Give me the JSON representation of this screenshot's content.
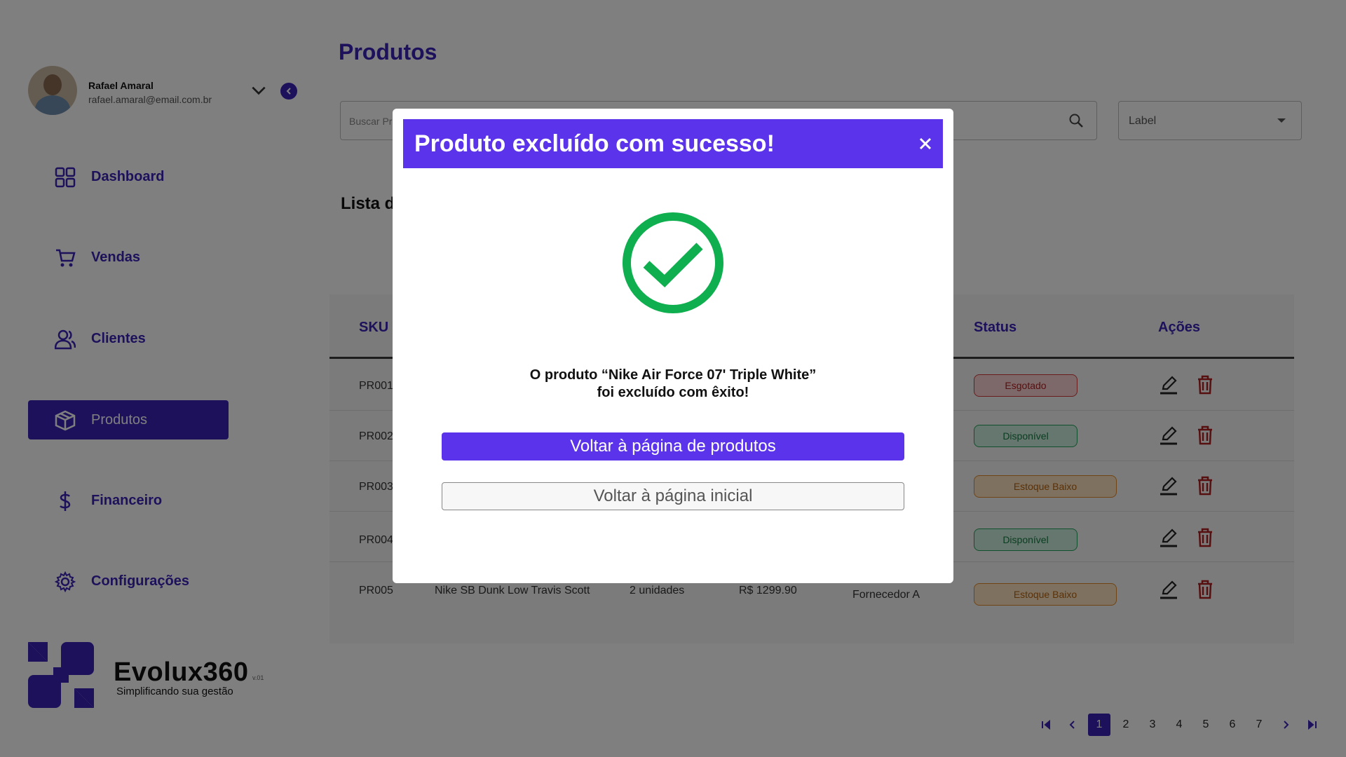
{
  "user": {
    "name": "Rafael Amaral",
    "email": "rafael.amaral@email.com.br"
  },
  "nav": [
    {
      "label": "Dashboard",
      "icon": "grid-icon"
    },
    {
      "label": "Vendas",
      "icon": "cart-icon"
    },
    {
      "label": "Clientes",
      "icon": "users-icon"
    },
    {
      "label": "Produtos",
      "icon": "box-icon",
      "active": true
    },
    {
      "label": "Financeiro",
      "icon": "dollar-icon"
    },
    {
      "label": "Configurações",
      "icon": "gear-icon"
    }
  ],
  "brand": {
    "name": "Evolux360",
    "version": "v.01",
    "tagline": "Simplificando sua gestão"
  },
  "page": {
    "title": "Produtos",
    "list_title": "Lista d"
  },
  "search": {
    "placeholder": "Buscar Pr"
  },
  "filter": {
    "value": "Label"
  },
  "table": {
    "headers": {
      "sku": "SKU",
      "status": "Status",
      "actions": "Ações"
    },
    "rows": [
      {
        "sku": "PR001",
        "status": "Esgotado",
        "status_type": "esgotado"
      },
      {
        "sku": "PR002",
        "status": "Disponível",
        "status_type": "disponivel"
      },
      {
        "sku": "PR003",
        "status": "Estoque Baixo",
        "status_type": "baixo"
      },
      {
        "sku": "PR004",
        "status": "Disponível",
        "status_type": "disponivel"
      },
      {
        "sku": "PR005",
        "name": "Nike SB Dunk Low Travis Scott",
        "stock": "2 unidades",
        "price": "R$ 1299.90",
        "supplier": "Fornecedor A",
        "status": "Estoque Baixo",
        "status_type": "baixo"
      }
    ]
  },
  "pagination": {
    "pages": [
      "1",
      "2",
      "3",
      "4",
      "5",
      "6",
      "7"
    ],
    "current": "1"
  },
  "modal": {
    "title": "Produto excluído com sucesso!",
    "message_line1": "O produto “Nike Air Force 07' Triple White”",
    "message_line2": "foi excluído com êxito!",
    "primary_button": "Voltar à página de produtos",
    "secondary_button": "Voltar à página inicial"
  },
  "colors": {
    "brand": "#3d22b8",
    "modal_accent": "#5b33ea",
    "success": "#0fae4e",
    "danger": "#b01e1e"
  }
}
